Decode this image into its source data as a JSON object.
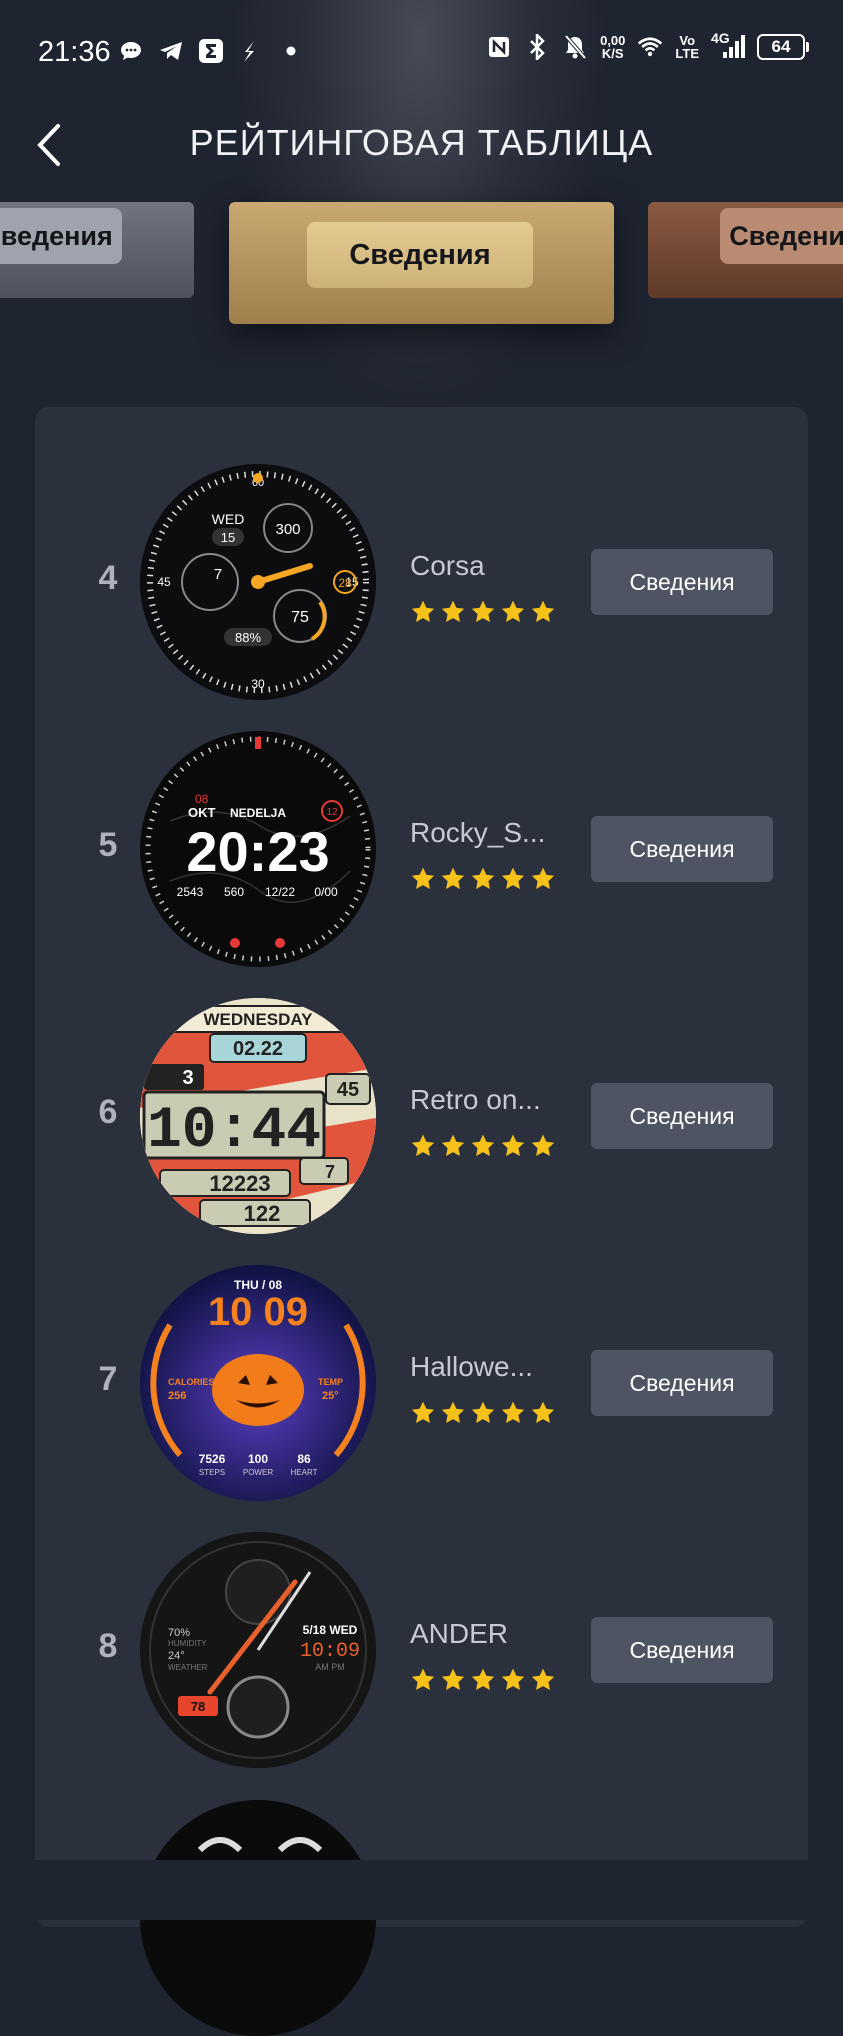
{
  "status_bar": {
    "time": "21:36",
    "net_speed_value": "0,00",
    "net_speed_unit": "K/S",
    "volte_top": "Vo",
    "volte_bottom": "LTE",
    "network": "4G",
    "battery": "64"
  },
  "header": {
    "title": "РЕЙТИНГОВАЯ ТАБЛИЦА"
  },
  "podium": {
    "left_button": "Сведения",
    "center_button": "Сведения",
    "right_button": "Сведения"
  },
  "leaderboard": [
    {
      "rank": "4",
      "name": "Corsa",
      "rating": 5,
      "button": "Сведения",
      "face": {
        "day": "WED",
        "date": "15",
        "value1": "300",
        "value2": "7",
        "value3": "28",
        "value4": "75",
        "battery": "88%"
      }
    },
    {
      "rank": "5",
      "name": "Rocky_S...",
      "rating": 5,
      "button": "Сведения",
      "face": {
        "month": "OKT",
        "weekday": "NEDELJA",
        "time": "20:23",
        "value1": "2543",
        "value2": "560",
        "value3": "12/22",
        "value4": "0/00"
      }
    },
    {
      "rank": "6",
      "name": "Retro on...",
      "rating": 5,
      "button": "Сведения",
      "face": {
        "day": "WEDNESDAY",
        "date": "02.22",
        "time": "10:44",
        "seconds": "45",
        "steps": "12223",
        "heart": "122",
        "top_num": "3",
        "temp": "7"
      }
    },
    {
      "rank": "7",
      "name": "Hallowe...",
      "rating": 5,
      "button": "Сведения",
      "face": {
        "date": "THU / 08",
        "time": "10 09",
        "calories_label": "CALORIES",
        "calories": "256",
        "temp_label": "TEMP",
        "temp": "25°",
        "steps": "7526",
        "power": "100",
        "heart": "86",
        "steps_label": "STEPS",
        "power_label": "POWER",
        "heart_label": "HEART"
      }
    },
    {
      "rank": "8",
      "name": "ANDER",
      "rating": 5,
      "button": "Сведения",
      "face": {
        "date": "5/18 WED",
        "time": "10:09",
        "ampm": "AM PM",
        "humidity": "70%",
        "humidity_label": "HUMIDITY",
        "temp": "24°",
        "weather_label": "WEATHER",
        "value": "78"
      }
    }
  ],
  "colors": {
    "background": "#1f2431",
    "panel": "#2b303d",
    "button": "#4e5462",
    "star": "#f6c21a",
    "gold": "#c8a972"
  }
}
